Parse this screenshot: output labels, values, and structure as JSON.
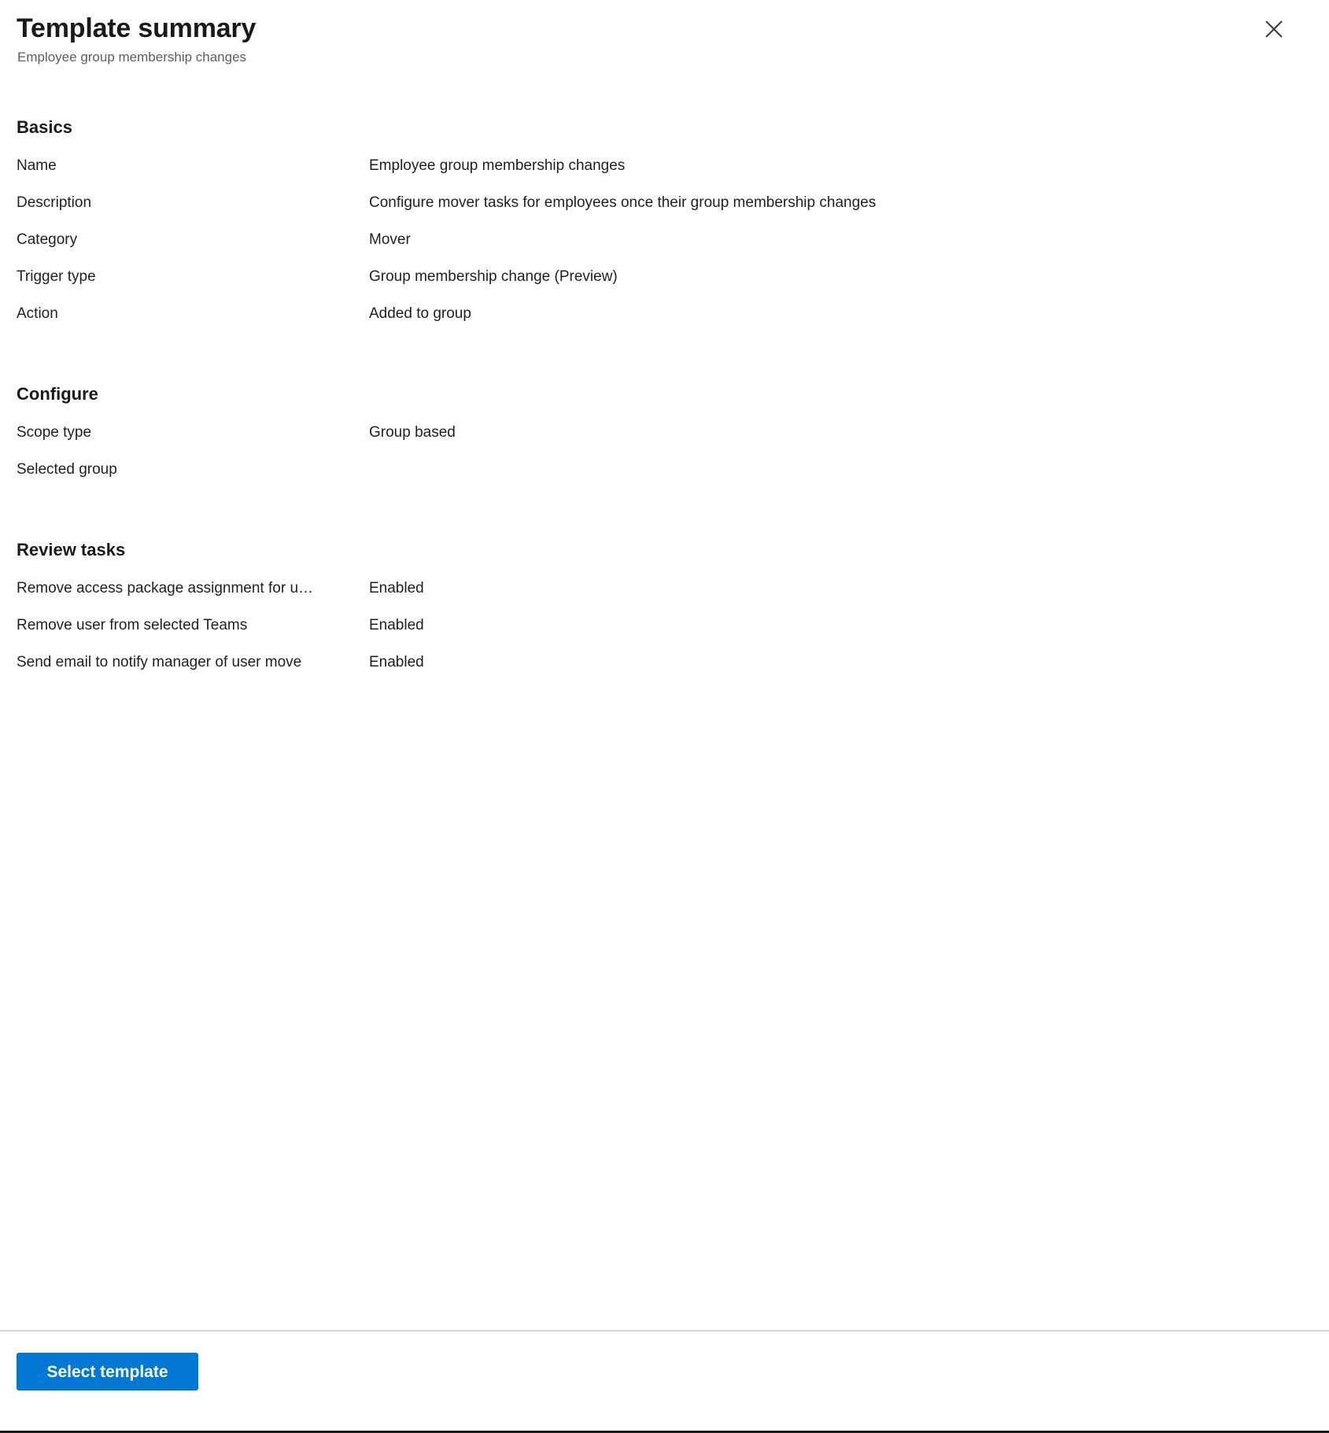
{
  "header": {
    "title": "Template summary",
    "subtitle": "Employee group membership changes",
    "close_icon": "close-icon"
  },
  "sections": [
    {
      "id": "basics",
      "title": "Basics",
      "rows": [
        {
          "label": "Name",
          "value": "Employee group membership changes"
        },
        {
          "label": "Description",
          "value": "Configure mover tasks for employees once their group membership changes"
        },
        {
          "label": "Category",
          "value": "Mover"
        },
        {
          "label": "Trigger type",
          "value": "Group membership change (Preview)"
        },
        {
          "label": "Action",
          "value": "Added to group"
        }
      ]
    },
    {
      "id": "configure",
      "title": "Configure",
      "rows": [
        {
          "label": "Scope type",
          "value": "Group based"
        },
        {
          "label": "Selected group",
          "value": ""
        }
      ]
    },
    {
      "id": "review",
      "title": "Review tasks",
      "rows": [
        {
          "label": "Remove access package assignment for u…",
          "value": "Enabled"
        },
        {
          "label": "Remove user from selected Teams",
          "value": "Enabled"
        },
        {
          "label": "Send email to notify manager of user move",
          "value": "Enabled"
        }
      ]
    }
  ],
  "footer": {
    "primary_button_label": "Select template"
  },
  "colors": {
    "accent": "#0078d4",
    "text": "#201f1e",
    "subtle_text": "#605e5c",
    "divider": "#d6d6d6"
  }
}
